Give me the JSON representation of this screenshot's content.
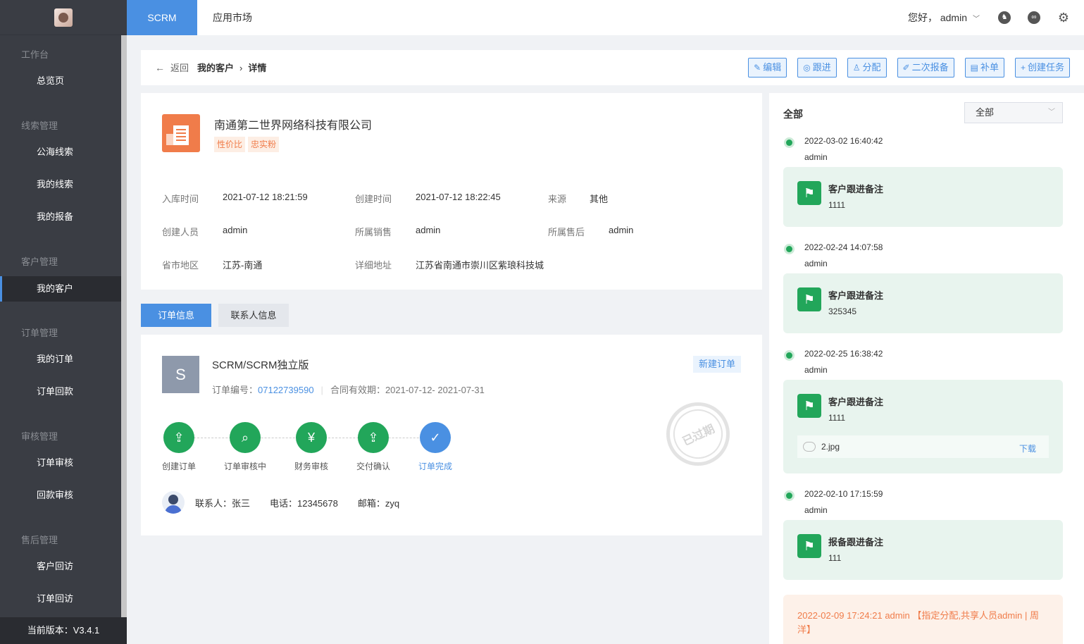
{
  "sidebar": {
    "groups": [
      {
        "title": "工作台",
        "items": [
          "总览页"
        ]
      },
      {
        "title": "线索管理",
        "items": [
          "公海线索",
          "我的线索",
          "我的报备"
        ]
      },
      {
        "title": "客户管理",
        "items": [
          "我的客户"
        ]
      },
      {
        "title": "订单管理",
        "items": [
          "我的订单",
          "订单回款"
        ]
      },
      {
        "title": "审核管理",
        "items": [
          "订单审核",
          "回款审核"
        ]
      },
      {
        "title": "售后管理",
        "items": [
          "客户回访",
          "订单回访"
        ]
      }
    ],
    "active_item": "我的客户",
    "version": "当前版本：V3.4.1"
  },
  "topbar": {
    "tabs": [
      "SCRM",
      "应用市场"
    ],
    "active_tab": "SCRM",
    "greeting": "您好， admin",
    "icons": [
      "robot-icon",
      "link-icon",
      "gear-icon"
    ]
  },
  "breadcrumb": {
    "back": "返回",
    "parent": "我的客户",
    "current": "详情"
  },
  "actions": [
    {
      "icon": "edit-icon",
      "glyph": "✎",
      "label": "编辑"
    },
    {
      "icon": "follow-icon",
      "glyph": "◎",
      "label": "跟进"
    },
    {
      "icon": "user-icon",
      "glyph": "♙",
      "label": "分配"
    },
    {
      "icon": "pen-icon",
      "glyph": "✐",
      "label": "二次报备"
    },
    {
      "icon": "doc-icon",
      "glyph": "▤",
      "label": "补单"
    },
    {
      "icon": "plus-icon",
      "glyph": "+",
      "label": "创建任务"
    }
  ],
  "company": {
    "name": "南通第二世界网络科技有限公司",
    "tags": [
      "性价比",
      "忠实粉"
    ],
    "fields": {
      "intake_time_label": "入库时间",
      "intake_time": "2021-07-12 18:21:59",
      "create_time_label": "创建时间",
      "create_time": "2021-07-12 18:22:45",
      "source_label": "来源",
      "source": "其他",
      "creator_label": "创建人员",
      "creator": "admin",
      "sales_label": "所属销售",
      "sales": "admin",
      "aftersales_label": "所属售后",
      "aftersales": "admin",
      "region_label": "省市地区",
      "region": "江苏-南通",
      "address_label": "详细地址",
      "address": "江苏省南通市崇川区紫琅科技城"
    }
  },
  "subtabs": [
    "订单信息",
    "联系人信息"
  ],
  "order": {
    "avatar_letter": "S",
    "product": "SCRM/SCRM独立版",
    "order_no_label": "订单编号：",
    "order_no": "07122739590",
    "validity": "合同有效期：2021-07-12- 2021-07-31",
    "new_order": "新建订单",
    "stamp": "已过期",
    "steps": [
      {
        "label": "创建订单",
        "icon": "create-order-icon"
      },
      {
        "label": "订单审核中",
        "icon": "review-icon"
      },
      {
        "label": "财务审核",
        "icon": "finance-icon"
      },
      {
        "label": "交付确认",
        "icon": "delivery-icon"
      },
      {
        "label": "订单完成",
        "icon": "shield-check-icon"
      }
    ],
    "contact": {
      "name": "联系人：张三",
      "phone": "电话：12345678",
      "email": "邮箱：zyq"
    }
  },
  "timeline": {
    "title": "全部",
    "filter": "全部",
    "entries": [
      {
        "time": "2022-03-02 16:40:42",
        "user": "admin",
        "title": "客户跟进备注",
        "body": "1111"
      },
      {
        "time": "2022-02-24 14:07:58",
        "user": "admin",
        "title": "客户跟进备注",
        "body": "325345"
      },
      {
        "time": "2022-02-25 16:38:42",
        "user": "admin",
        "title": "客户跟进备注",
        "body": "1111",
        "attachment": "2.jpg",
        "download": "下载"
      },
      {
        "time": "2022-02-10 17:15:59",
        "user": "admin",
        "title": "报备跟进备注",
        "body": "111"
      }
    ],
    "assign_note": "2022-02-09 17:24:21 admin 【指定分配,共享人员admin | 周洋】"
  }
}
